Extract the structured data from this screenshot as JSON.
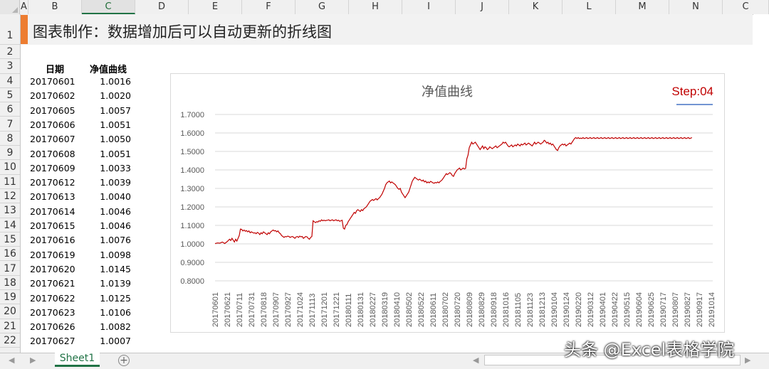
{
  "spreadsheet": {
    "columns": [
      "A",
      "B",
      "C",
      "D",
      "E",
      "F",
      "G",
      "H",
      "I",
      "J",
      "K",
      "L",
      "M",
      "N",
      "C"
    ],
    "rows": [
      "1",
      "2",
      "3",
      "4",
      "5",
      "6",
      "7",
      "8",
      "9",
      "10",
      "11",
      "12",
      "13",
      "14",
      "15",
      "16",
      "17",
      "18",
      "19",
      "20",
      "21",
      "22"
    ],
    "title": "图表制作：数据增加后可以自动更新的折线图",
    "header_date": "日期",
    "header_nav": "净值曲线",
    "data_rows": [
      {
        "date": "20170601",
        "value": "1.0016"
      },
      {
        "date": "20170602",
        "value": "1.0020"
      },
      {
        "date": "20170605",
        "value": "1.0057"
      },
      {
        "date": "20170606",
        "value": "1.0051"
      },
      {
        "date": "20170607",
        "value": "1.0050"
      },
      {
        "date": "20170608",
        "value": "1.0051"
      },
      {
        "date": "20170609",
        "value": "1.0033"
      },
      {
        "date": "20170612",
        "value": "1.0039"
      },
      {
        "date": "20170613",
        "value": "1.0040"
      },
      {
        "date": "20170614",
        "value": "1.0046"
      },
      {
        "date": "20170615",
        "value": "1.0046"
      },
      {
        "date": "20170616",
        "value": "1.0076"
      },
      {
        "date": "20170619",
        "value": "1.0098"
      },
      {
        "date": "20170620",
        "value": "1.0145"
      },
      {
        "date": "20170621",
        "value": "1.0139"
      },
      {
        "date": "20170622",
        "value": "1.0125"
      },
      {
        "date": "20170623",
        "value": "1.0106"
      },
      {
        "date": "20170626",
        "value": "1.0082"
      },
      {
        "date": "20170627",
        "value": "1.0007"
      }
    ],
    "sheet_tab": "Sheet1",
    "add_sheet": "+",
    "nav_prev": "◀",
    "nav_next": "▶",
    "scroll_left": "◀",
    "scroll_right": "▶"
  },
  "watermark": "头条 @Excel表格学院",
  "chart_data": {
    "type": "line",
    "title": "净值曲线",
    "step_label": "Step:04",
    "step_color": "#c00000",
    "line_color": "#c00000",
    "ylim": [
      0.8,
      1.7
    ],
    "yticks": [
      "0.8000",
      "0.9000",
      "1.0000",
      "1.1000",
      "1.2000",
      "1.3000",
      "1.4000",
      "1.5000",
      "1.6000",
      "1.7000"
    ],
    "xtick_labels": [
      "20170601",
      "20170621",
      "20170711",
      "20170731",
      "20170818",
      "20170907",
      "20170927",
      "20171024",
      "20171113",
      "20171201",
      "20171221",
      "20180111",
      "20180131",
      "20180227",
      "20180319",
      "20180410",
      "20180502",
      "20180522",
      "20180611",
      "20180702",
      "20180720",
      "20180809",
      "20180829",
      "20180918",
      "20181016",
      "20181105",
      "20181123",
      "20181213",
      "20190104",
      "20190124",
      "20190220",
      "20190312",
      "20190401",
      "20190422",
      "20190515",
      "20190604",
      "20190625",
      "20190717",
      "20190807",
      "20190827",
      "20190917",
      "20191014"
    ],
    "x": [
      0,
      4,
      8,
      12,
      16,
      20,
      24,
      26,
      28,
      30,
      32,
      34,
      36,
      38,
      40,
      42,
      44,
      46,
      48,
      50,
      52,
      54,
      56,
      58,
      60,
      62,
      64,
      66,
      68,
      70,
      72,
      74,
      76,
      78,
      80,
      82,
      84,
      86,
      88,
      90,
      92,
      94,
      96,
      98,
      100,
      102,
      104,
      106,
      108,
      110,
      112,
      114,
      116,
      118,
      120,
      122,
      124,
      126,
      128,
      130,
      132,
      134,
      136,
      138,
      140,
      142,
      144,
      146,
      148,
      150,
      152,
      154,
      156,
      158,
      160,
      162,
      164,
      166,
      168,
      170,
      172,
      174,
      176,
      178,
      180,
      182,
      184,
      186,
      188,
      190,
      192,
      194,
      196,
      198,
      200,
      202,
      204,
      206,
      208,
      210,
      212,
      214,
      216,
      218,
      220,
      222,
      224,
      226,
      228,
      230,
      232,
      234,
      236,
      238,
      240,
      242,
      244,
      246,
      248,
      250,
      252,
      254,
      256,
      258,
      260,
      262,
      264,
      266,
      268,
      270,
      272,
      274,
      276,
      278,
      280,
      282,
      284,
      286,
      288,
      290,
      292,
      294,
      296,
      298,
      300,
      302,
      304,
      306,
      308,
      310,
      312,
      314,
      316,
      318,
      320,
      322,
      324,
      326,
      328,
      330,
      332,
      334,
      336,
      338,
      340,
      342,
      344,
      346,
      348,
      350,
      352,
      354,
      356,
      358,
      360,
      362,
      364,
      366,
      368,
      370,
      372,
      374,
      376,
      378,
      380,
      382,
      384,
      386,
      388,
      390,
      392,
      394,
      396,
      398,
      400,
      402,
      404,
      406,
      408,
      410,
      412,
      414,
      416,
      418,
      420,
      422,
      424,
      426,
      428,
      430,
      432,
      434,
      436,
      438,
      440,
      442,
      444,
      446,
      448,
      450,
      452,
      454,
      456,
      458,
      460,
      462,
      464,
      466,
      468,
      470,
      472,
      474,
      476,
      478,
      480,
      482,
      484,
      486,
      488,
      490,
      492,
      494,
      496,
      498,
      500,
      502,
      504,
      506,
      508,
      510,
      512,
      514,
      516,
      518,
      520,
      522,
      524,
      526,
      528,
      530,
      532,
      534,
      536,
      538,
      540,
      542,
      544,
      546,
      548,
      550,
      552,
      554,
      556,
      558,
      560,
      562,
      564,
      566,
      568,
      570,
      572,
      574,
      576,
      578,
      580,
      582,
      584,
      586,
      588,
      590,
      592,
      594,
      596,
      598,
      600,
      602,
      604,
      606,
      608,
      610,
      612,
      614,
      616,
      618,
      620,
      622,
      624,
      626,
      628,
      630,
      632,
      634,
      636,
      638,
      640,
      642,
      644,
      646,
      648,
      650,
      652,
      654,
      656,
      658,
      660,
      662,
      664,
      666,
      668,
      670,
      672,
      674,
      676,
      678,
      680,
      682,
      684,
      686,
      688,
      690,
      692,
      694,
      696,
      698,
      700,
      702,
      704,
      706,
      708,
      710,
      712,
      714,
      716,
      718,
      720,
      722,
      724,
      726,
      728,
      730,
      732,
      734,
      736,
      738,
      740,
      742,
      744,
      746,
      748,
      750,
      752,
      754,
      756,
      758,
      760,
      762,
      764,
      766,
      768,
      770,
      772,
      774,
      776,
      778,
      780,
      782,
      784,
      786,
      788,
      790,
      792,
      794,
      796,
      798,
      800,
      802,
      804,
      806,
      808,
      810,
      812,
      814,
      816,
      818,
      820
    ],
    "y": [
      1.0016,
      1.005,
      1.004,
      1.01,
      1.002,
      1.012,
      1.025,
      1.018,
      1.03,
      1.02,
      1.01,
      1.025,
      1.015,
      1.03,
      1.045,
      1.08,
      1.078,
      1.07,
      1.075,
      1.068,
      1.072,
      1.065,
      1.07,
      1.06,
      1.065,
      1.062,
      1.058,
      1.06,
      1.055,
      1.062,
      1.058,
      1.05,
      1.06,
      1.055,
      1.065,
      1.06,
      1.055,
      1.05,
      1.06,
      1.055,
      1.065,
      1.07,
      1.075,
      1.07,
      1.072,
      1.065,
      1.07,
      1.06,
      1.055,
      1.045,
      1.04,
      1.035,
      1.04,
      1.038,
      1.042,
      1.04,
      1.035,
      1.038,
      1.04,
      1.035,
      1.03,
      1.038,
      1.04,
      1.035,
      1.042,
      1.038,
      1.04,
      1.03,
      1.035,
      1.04,
      1.038,
      1.03,
      1.025,
      1.035,
      1.04,
      1.125,
      1.12,
      1.115,
      1.12,
      1.118,
      1.125,
      1.122,
      1.13,
      1.125,
      1.128,
      1.125,
      1.127,
      1.128,
      1.13,
      1.125,
      1.128,
      1.13,
      1.125,
      1.128,
      1.13,
      1.125,
      1.128,
      1.122,
      1.125,
      1.128,
      1.085,
      1.08,
      1.1,
      1.105,
      1.12,
      1.13,
      1.14,
      1.15,
      1.16,
      1.17,
      1.165,
      1.18,
      1.185,
      1.18,
      1.175,
      1.185,
      1.18,
      1.19,
      1.195,
      1.2,
      1.21,
      1.22,
      1.23,
      1.235,
      1.24,
      1.235,
      1.24,
      1.245,
      1.238,
      1.245,
      1.25,
      1.26,
      1.27,
      1.285,
      1.3,
      1.32,
      1.33,
      1.335,
      1.34,
      1.33,
      1.335,
      1.33,
      1.325,
      1.32,
      1.31,
      1.3,
      1.295,
      1.3,
      1.28,
      1.27,
      1.26,
      1.25,
      1.26,
      1.27,
      1.28,
      1.3,
      1.32,
      1.34,
      1.35,
      1.36,
      1.355,
      1.35,
      1.345,
      1.35,
      1.345,
      1.34,
      1.345,
      1.335,
      1.34,
      1.33,
      1.335,
      1.33,
      1.338,
      1.335,
      1.33,
      1.328,
      1.332,
      1.33,
      1.335,
      1.33,
      1.338,
      1.342,
      1.35,
      1.36,
      1.37,
      1.38,
      1.375,
      1.38,
      1.385,
      1.38,
      1.37,
      1.365,
      1.38,
      1.39,
      1.4,
      1.405,
      1.41,
      1.4,
      1.405,
      1.41,
      1.405,
      1.408,
      1.46,
      1.48,
      1.52,
      1.535,
      1.55,
      1.54,
      1.545,
      1.55,
      1.54,
      1.53,
      1.52,
      1.51,
      1.52,
      1.53,
      1.515,
      1.525,
      1.52,
      1.51,
      1.515,
      1.525,
      1.52,
      1.515,
      1.52,
      1.525,
      1.53,
      1.52,
      1.525,
      1.53,
      1.535,
      1.54,
      1.55,
      1.545,
      1.55,
      1.54,
      1.53,
      1.525,
      1.53,
      1.535,
      1.525,
      1.53,
      1.535,
      1.53,
      1.54,
      1.535,
      1.53,
      1.54,
      1.535,
      1.54,
      1.545,
      1.535,
      1.54,
      1.545,
      1.54,
      1.535,
      1.53,
      1.54,
      1.55,
      1.54,
      1.545,
      1.55,
      1.545,
      1.54,
      1.545,
      1.55,
      1.56,
      1.555,
      1.545,
      1.55,
      1.54,
      1.545,
      1.535,
      1.54,
      1.53,
      1.52,
      1.51,
      1.505,
      1.52,
      1.53,
      1.535,
      1.54,
      1.535,
      1.54,
      1.53,
      1.535,
      1.54,
      1.545,
      1.54,
      1.55,
      1.56,
      1.57,
      1.575,
      1.57,
      1.575,
      1.57,
      1.572,
      1.57,
      1.575,
      1.57,
      1.572,
      1.575,
      1.57,
      1.572,
      1.575,
      1.57,
      1.572,
      1.575,
      1.57,
      1.572,
      1.575,
      1.57,
      1.572,
      1.575,
      1.57,
      1.572,
      1.575,
      1.57,
      1.572,
      1.575,
      1.57,
      1.572,
      1.575,
      1.57,
      1.572,
      1.575,
      1.57,
      1.572,
      1.575,
      1.57,
      1.572,
      1.575,
      1.57,
      1.572,
      1.575,
      1.57,
      1.572,
      1.575,
      1.57,
      1.572,
      1.575,
      1.57,
      1.572,
      1.575,
      1.57,
      1.572,
      1.575,
      1.57,
      1.572,
      1.575,
      1.57,
      1.572,
      1.575,
      1.57,
      1.572,
      1.575,
      1.57,
      1.572,
      1.575,
      1.57,
      1.572,
      1.575,
      1.57,
      1.572,
      1.575,
      1.57,
      1.572,
      1.575,
      1.57,
      1.572,
      1.575,
      1.57,
      1.572,
      1.575,
      1.57,
      1.572,
      1.575,
      1.57,
      1.572,
      1.575,
      1.57,
      1.572,
      1.575,
      1.57,
      1.572,
      1.575,
      1.57,
      1.572,
      1.575
    ]
  }
}
